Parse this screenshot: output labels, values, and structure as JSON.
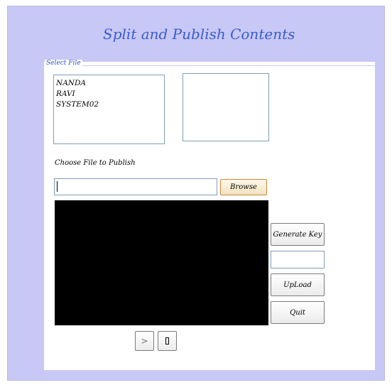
{
  "window": {
    "title": "Split and Publish Contents"
  },
  "select_file": {
    "legend": "Select File",
    "users": [
      "NANDA",
      "RAVI",
      "SYSTEM02"
    ],
    "second_list_items": []
  },
  "publish": {
    "choose_label": "Choose File to Publish",
    "file_path_value": "",
    "browse_label": "Browse"
  },
  "actions": {
    "generate_key_label": "Generate Key",
    "key_value": "",
    "upload_label": "UpLoad",
    "quit_label": "Quit"
  },
  "player": {
    "play_symbol": ">",
    "stop_icon": "stop-icon"
  },
  "colors": {
    "frame_background": "#c8c8f6",
    "title_color": "#3a5cc8",
    "video_background": "#000000",
    "browse_border": "#c08a3a"
  }
}
